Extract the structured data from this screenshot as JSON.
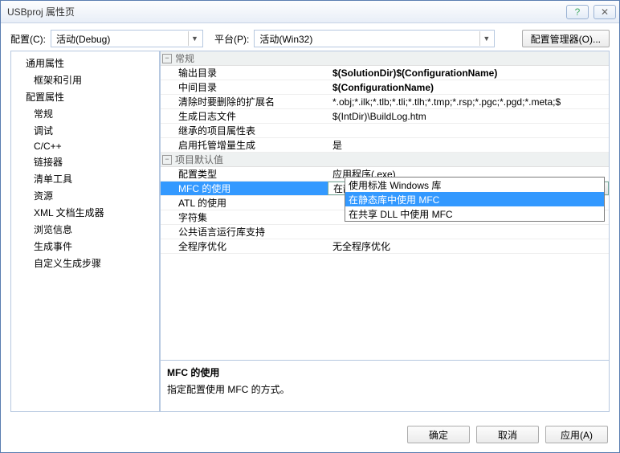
{
  "titlebar": {
    "title": "USBproj 属性页"
  },
  "title_buttons": {
    "help": "?",
    "close": "✕"
  },
  "config_row": {
    "config_label": "配置(C):",
    "config_value": "活动(Debug)",
    "platform_label": "平台(P):",
    "platform_value": "活动(Win32)",
    "manager_btn": "配置管理器(O)..."
  },
  "tree": [
    {
      "label": "通用属性",
      "top": true
    },
    {
      "label": "框架和引用"
    },
    {
      "label": "配置属性",
      "top": true
    },
    {
      "label": "常规"
    },
    {
      "label": "调试"
    },
    {
      "label": "C/C++"
    },
    {
      "label": "链接器"
    },
    {
      "label": "清单工具"
    },
    {
      "label": "资源"
    },
    {
      "label": "XML 文档生成器"
    },
    {
      "label": "浏览信息"
    },
    {
      "label": "生成事件"
    },
    {
      "label": "自定义生成步骤"
    }
  ],
  "groups": {
    "general": {
      "name": "常规",
      "toggle": "−"
    },
    "defaults": {
      "name": "项目默认值",
      "toggle": "−"
    }
  },
  "props": {
    "output_dir": {
      "label": "输出目录",
      "value": "$(SolutionDir)$(ConfigurationName)",
      "bold": true
    },
    "inter_dir": {
      "label": "中间目录",
      "value": "$(ConfigurationName)",
      "bold": true
    },
    "clean_ext": {
      "label": "清除时要删除的扩展名",
      "value": "*.obj;*.ilk;*.tlb;*.tli;*.tlh;*.tmp;*.rsp;*.pgc;*.pgd;*.meta;$"
    },
    "build_log": {
      "label": "生成日志文件",
      "value": "$(IntDir)\\BuildLog.htm"
    },
    "inherit": {
      "label": "继承的项目属性表",
      "value": ""
    },
    "managed_inc": {
      "label": "启用托管增量生成",
      "value": "是"
    },
    "config_type": {
      "label": "配置类型",
      "value": "应用程序(.exe)"
    },
    "mfc_use": {
      "label": "MFC 的使用",
      "value": "在静态库中使用 MFC"
    },
    "atl_use": {
      "label": "ATL 的使用",
      "value": ""
    },
    "charset": {
      "label": "字符集",
      "value": ""
    },
    "clr": {
      "label": "公共语言运行库支持",
      "value": ""
    },
    "wpo": {
      "label": "全程序优化",
      "value": "无全程序优化"
    }
  },
  "dropdown_options": [
    {
      "label": "使用标准 Windows 库",
      "selected": false
    },
    {
      "label": "在静态库中使用 MFC",
      "selected": true
    },
    {
      "label": "在共享 DLL 中使用 MFC",
      "selected": false
    }
  ],
  "description": {
    "title": "MFC 的使用",
    "text": "指定配置使用 MFC 的方式。"
  },
  "footer": {
    "ok": "确定",
    "cancel": "取消",
    "apply": "应用(A)"
  }
}
